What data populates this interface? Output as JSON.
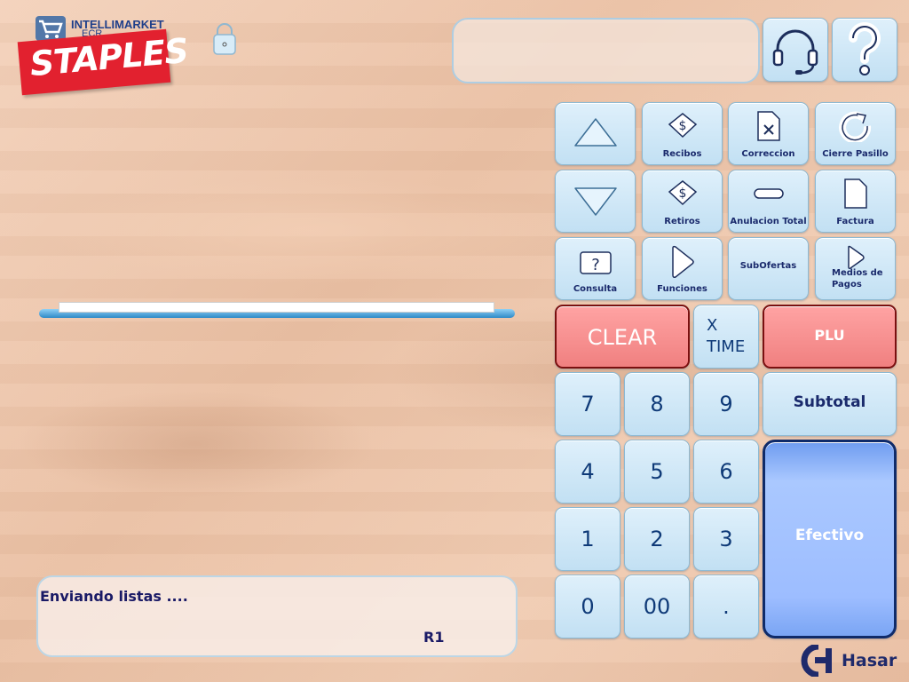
{
  "branding": {
    "product_line1": "INTELLIMARKET",
    "product_line2": "ECR",
    "store": "STAPLES",
    "vendor": "Hasar"
  },
  "header": {
    "display_text": ""
  },
  "function_keys": {
    "recibos": "Recibos",
    "correccion": "Correccion",
    "cierre_pasillo": "Cierre Pasillo",
    "retiros": "Retiros",
    "anulacion_total": "Anulacion Total",
    "factura": "Factura",
    "consulta": "Consulta",
    "funciones": "Funciones",
    "subofertas": "SubOfertas",
    "medios_de_pagos": "Medios de Pagos"
  },
  "keypad": {
    "clear": "CLEAR",
    "x_time_line1": "X",
    "x_time_line2": "TIME",
    "plu": "PLU",
    "subtotal": "Subtotal",
    "efectivo": "Efectivo",
    "k7": "7",
    "k8": "8",
    "k9": "9",
    "k4": "4",
    "k5": "5",
    "k6": "6",
    "k1": "1",
    "k2": "2",
    "k3": "3",
    "k0": "0",
    "k00": "00",
    "kdot": "."
  },
  "status": {
    "message": "Enviando listas ....",
    "register": "R1",
    "progress_fraction": 0.91
  },
  "colors": {
    "button_blue": "#c2e0f3",
    "clear_red": "#f08080",
    "efectivo_blue": "#9dbdff",
    "text_navy": "#1a2a6c"
  }
}
